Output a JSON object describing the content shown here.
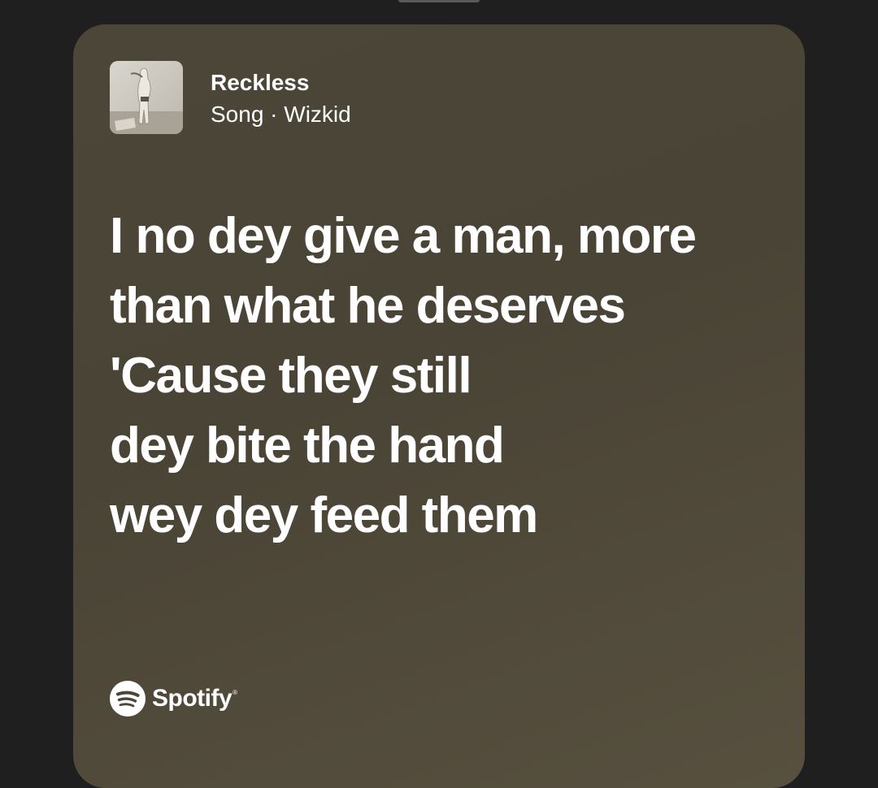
{
  "song": {
    "title": "Reckless",
    "subtitle": "Song · Wizkid"
  },
  "lyrics": [
    "I no dey give a man, more",
    "than what he deserves",
    "'Cause they still",
    "dey bite the hand",
    "wey dey feed them"
  ],
  "brand": {
    "name": "Spotify",
    "mark": "®",
    "icon": "spotify-logo"
  },
  "colors": {
    "page_background": "#1f1f1f",
    "card_background": "#4c4638",
    "text": "#ffffff"
  }
}
